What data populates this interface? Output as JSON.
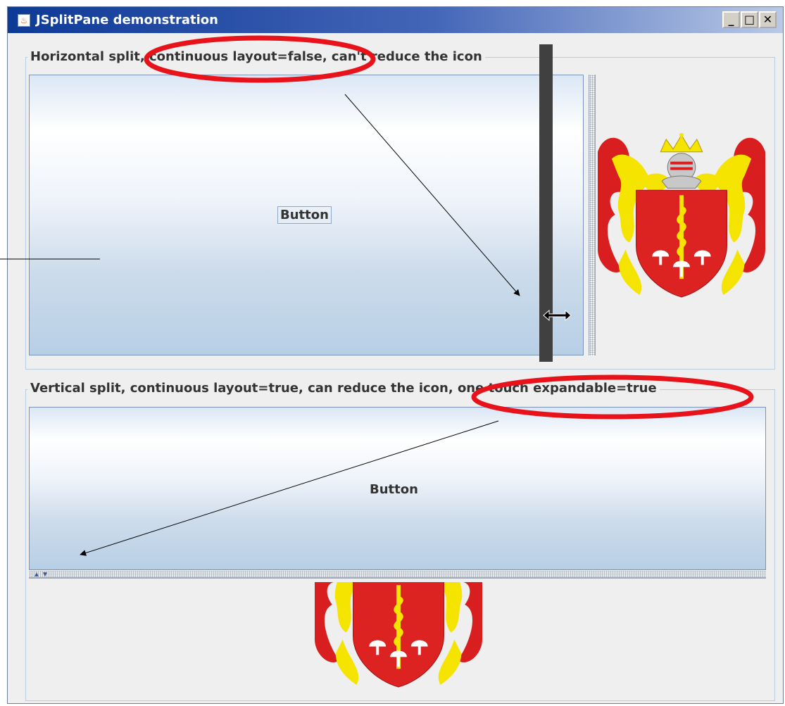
{
  "window": {
    "title": "JSplitPane demonstration",
    "controls": {
      "minimize": "_",
      "maximize": "□",
      "close": "✕"
    }
  },
  "horizontal_section": {
    "title": "Horizontal split, continuous layout=false, can't reduce the icon",
    "button_label": "Button",
    "right_pane_image": "coat-of-arms"
  },
  "vertical_section": {
    "title": "Vertical split, continuous layout=true, can reduce the icon, one touch expandable=true",
    "button_label": "Button",
    "bottom_pane_image": "coat-of-arms"
  },
  "icons": {
    "app": "java-cup-icon",
    "resize_cursor": "horizontal-resize-cursor-icon",
    "one_touch_up": "triangle-up-icon",
    "one_touch_down": "triangle-down-icon"
  },
  "colors": {
    "title_gradient_start": "#0d3a96",
    "annotation_ellipse": "#e8121b",
    "divider_drag_bar": "#404040",
    "shield_red": "#dd2222",
    "mantle_yellow": "#f5e300"
  }
}
